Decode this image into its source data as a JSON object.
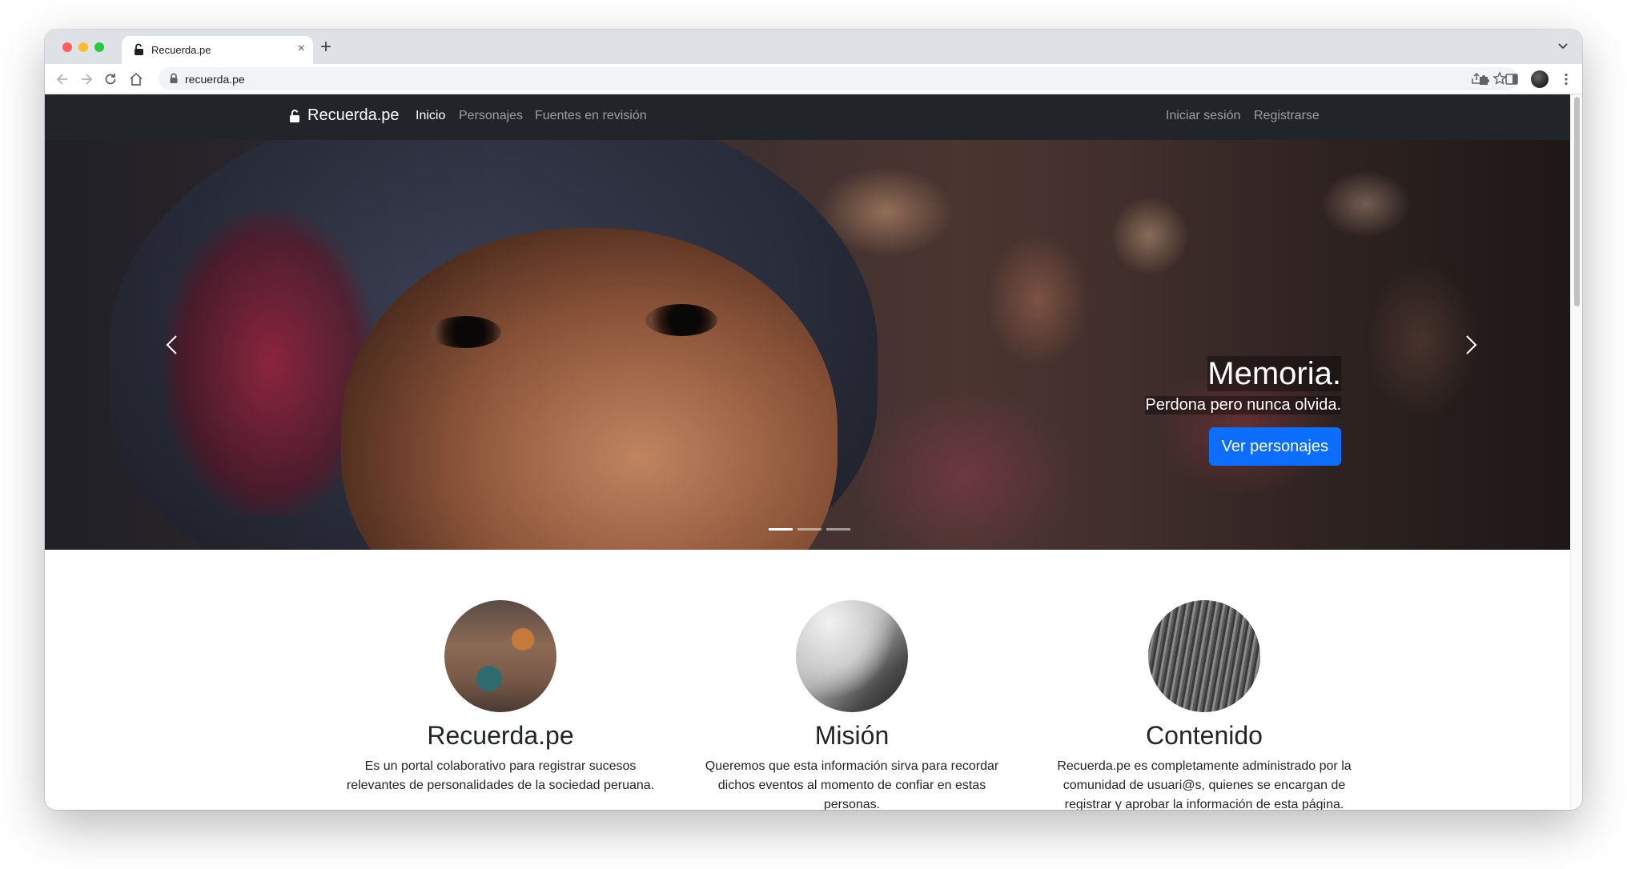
{
  "browser": {
    "tab_title": "Recuerda.pe",
    "tab_close": "×",
    "new_tab": "+",
    "url": "recuerda.pe"
  },
  "navbar": {
    "brand": "Recuerda.pe",
    "links": [
      "Inicio",
      "Personajes",
      "Fuentes en revisión"
    ],
    "right_links": [
      "Iniciar sesión",
      "Registrarse"
    ]
  },
  "hero": {
    "heading": "Memoria.",
    "subheading": "Perdona pero nunca olvida.",
    "button": "Ver personajes",
    "slides": 3,
    "active_slide": 0
  },
  "features": [
    {
      "title": "Recuerda.pe",
      "text": "Es un portal colaborativo para registrar sucesos relevantes de personalidades de la sociedad peruana."
    },
    {
      "title": "Misión",
      "text": "Queremos que esta información sirva para recordar dichos eventos al momento de confiar en estas personas."
    },
    {
      "title": "Contenido",
      "text": "Recuerda.pe es completamente administrado por la comunidad de usuari@s, quienes se encargan de registrar y aprobar la información de esta página."
    }
  ],
  "colors": {
    "navbar_bg": "#212529",
    "primary": "#0d6efd"
  }
}
